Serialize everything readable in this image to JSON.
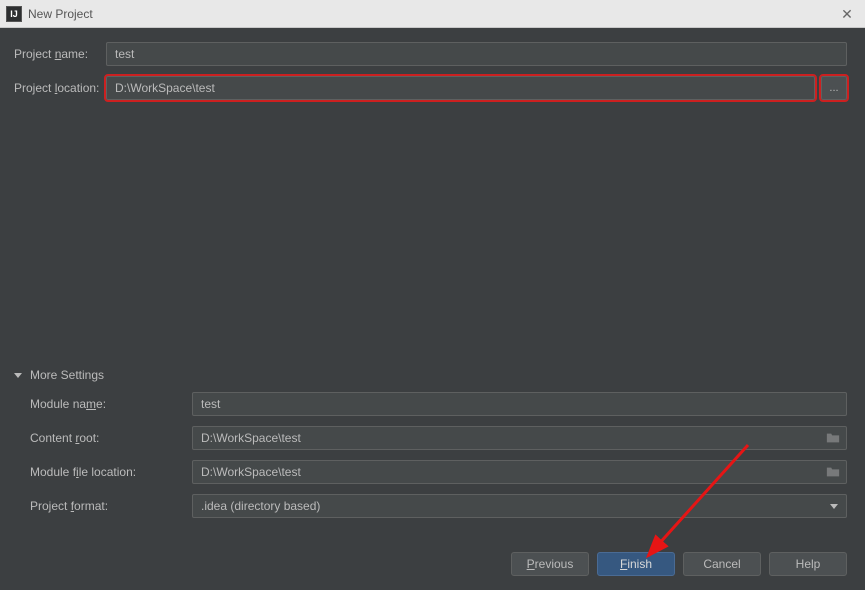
{
  "titlebar": {
    "title": "New Project"
  },
  "form": {
    "projectNameLabel": "Project ",
    "projectNameMnemonic": "n",
    "projectNameLabelTail": "ame:",
    "projectName": "test",
    "projectLocationLabel": "Project ",
    "projectLocationMnemonic": "l",
    "projectLocationLabelTail": "ocation:",
    "projectLocation": "D:\\WorkSpace\\test",
    "browseLabel": "..."
  },
  "more": {
    "header": "More Settings",
    "moduleNameLabel": "Module na",
    "moduleNameMnemonic": "m",
    "moduleNameLabelTail": "e:",
    "moduleName": "test",
    "contentRootLabel": "Content ",
    "contentRootMnemonic": "r",
    "contentRootLabelTail": "oot:",
    "contentRoot": "D:\\WorkSpace\\test",
    "moduleFileLabel": "Module f",
    "moduleFileMnemonic": "i",
    "moduleFileLabelTail": "le location:",
    "moduleFileLocation": "D:\\WorkSpace\\test",
    "projectFormatLabel": "Project ",
    "projectFormatMnemonic": "f",
    "projectFormatLabelTail": "ormat:",
    "projectFormat": ".idea (directory based)"
  },
  "buttons": {
    "previousMnemonic": "P",
    "previousTail": "revious",
    "finishMnemonic": "F",
    "finishTail": "inish",
    "cancel": "Cancel",
    "help": "Help"
  }
}
